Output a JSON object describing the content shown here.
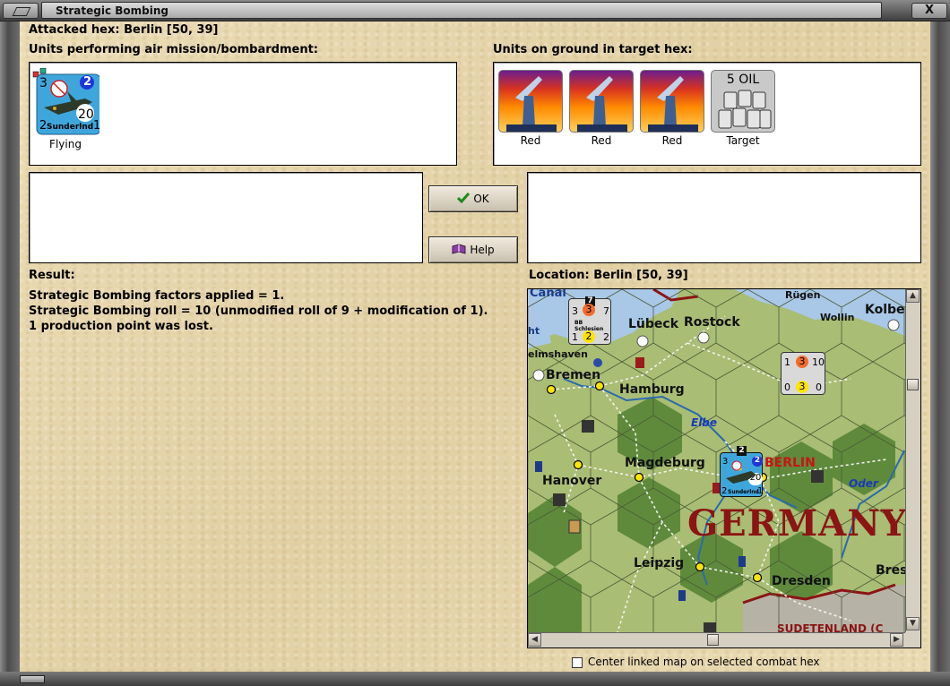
{
  "window": {
    "title": "Strategic Bombing",
    "close_glyph": "X"
  },
  "attacked_hex": "Attacked hex: Berlin  [50, 39]",
  "air_units": {
    "heading": "Units performing air mission/bombardment:",
    "items": [
      {
        "unit_name": "Sunderlnd",
        "status": "Flying",
        "top_left_value": "3",
        "top_right_value": "2",
        "center_value": "20",
        "bottom_left_value": "2",
        "bottom_right_value": "1"
      }
    ]
  },
  "ground_units": {
    "heading": "Units on ground in target hex:",
    "items": [
      {
        "icon": "anti-aircraft-gun-icon",
        "caption": "Red"
      },
      {
        "icon": "anti-aircraft-gun-icon",
        "caption": "Red"
      },
      {
        "icon": "anti-aircraft-gun-icon",
        "caption": "Red"
      },
      {
        "icon": "oil-barrels-icon",
        "caption": "Target",
        "tile_text": "5 OIL"
      }
    ]
  },
  "buttons": {
    "ok_label": "OK",
    "help_label": "Help"
  },
  "result": {
    "heading": "Result:",
    "lines": [
      "Strategic Bombing factors applied = 1.",
      "Strategic Bombing roll = 10 (unmodified roll of 9 + modification of 1).",
      "1 production point was lost."
    ]
  },
  "location": {
    "heading": "Location:  Berlin  [50, 39]"
  },
  "map": {
    "country_label": "GERMANY",
    "target_city": "BERLIN",
    "cities": [
      "Canal",
      "Rügen",
      "Lübeck",
      "Rostock",
      "Wollin",
      "Kolbe",
      "ht",
      "elmshaven",
      "Bremen",
      "Hamburg",
      "Magdeburg",
      "Hanover",
      "Leipzig",
      "Dresden",
      "Bres",
      "SUDETENLAND (C"
    ],
    "rivers": [
      "Elbe",
      "Oder"
    ],
    "ship_counter_1": {
      "name": "BB Schlesien",
      "top": [
        "3",
        "3",
        "7"
      ],
      "top_badge": "7",
      "bottom": [
        "1",
        "2",
        "2"
      ]
    },
    "ship_counter_2": {
      "top": [
        "1",
        "3",
        "10"
      ],
      "bottom": [
        "0",
        "3",
        "0"
      ]
    },
    "air_counter": {
      "name": "Sunderlnd",
      "top_left": "3",
      "top_right": "2",
      "center": "20",
      "bottom_left": "2",
      "bottom_right": "1",
      "badge": "2"
    },
    "colors": {
      "hex_fill": "#9fb56f",
      "forest": "#5f8a3c",
      "sea": "#a9c7e6",
      "mountain": "#b7b2a6",
      "germany_label": "#8b1414"
    }
  },
  "scroll_glyphs": {
    "up": "▲",
    "down": "▼",
    "left": "◀",
    "right": "▶"
  },
  "checkbox": {
    "label": "Center linked map on selected combat hex",
    "checked": false
  }
}
